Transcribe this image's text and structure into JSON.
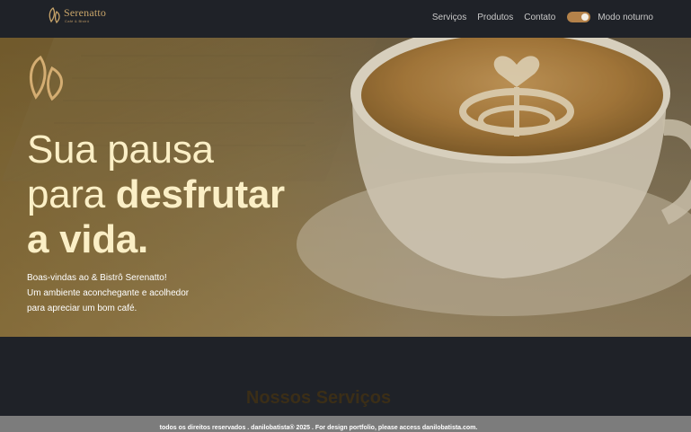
{
  "header": {
    "brand_name": "Serenatto",
    "brand_sub": "Café & Bistrô",
    "nav": [
      "Serviços",
      "Produtos",
      "Contato"
    ],
    "dark_mode_label": "Modo noturno",
    "dark_mode_on": true
  },
  "hero": {
    "title_line1": "Sua pausa",
    "title_line2_normal": "para ",
    "title_line2_bold": "desfrutar",
    "title_line3": "a vida.",
    "text_line1": "Boas-vindas ao & Bistrô Serenatto!",
    "text_line2": "Um ambiente aconchegante e acolhedor",
    "text_line3": "para apreciar um bom café."
  },
  "services": {
    "title": "Nossos Serviços"
  },
  "footer": {
    "text": "todos os direitos reservados . danilobatista® 2025 . For design portfolio, please access danilobatista.com."
  },
  "colors": {
    "accent": "#c9a56a",
    "background": "#1f2228",
    "hero_text": "#fbefc6",
    "toggle": "#b4824a",
    "footer": "#7c7c7c"
  }
}
